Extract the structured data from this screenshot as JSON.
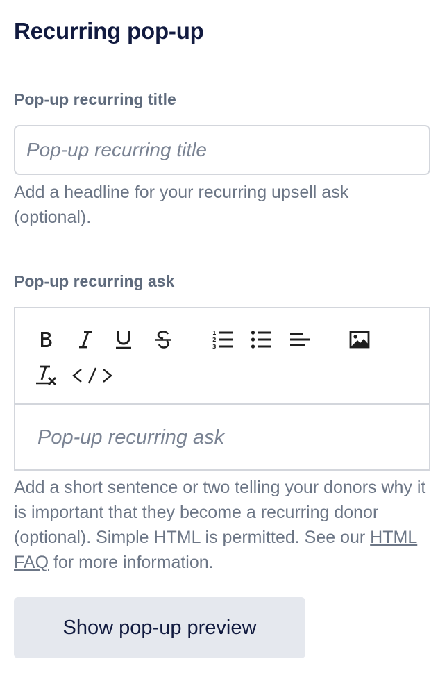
{
  "section": {
    "title": "Recurring pop-up"
  },
  "recurring_title": {
    "label": "Pop-up recurring title",
    "value": "",
    "placeholder": "Pop-up recurring title",
    "help": "Add a headline for your recurring upsell ask (optional)."
  },
  "recurring_ask": {
    "label": "Pop-up recurring ask",
    "placeholder": "Pop-up recurring ask",
    "help_before_link": "Add a short sentence or two telling your donors why it is important that they become a recurring donor (optional). Simple HTML is permitted. See our ",
    "help_link": "HTML FAQ",
    "help_after_link": " for more information.",
    "toolbar": [
      "bold-icon",
      "italic-icon",
      "underline-icon",
      "strikethrough-icon",
      "ordered-list-icon",
      "bullet-list-icon",
      "align-icon",
      "image-icon",
      "clear-format-icon",
      "code-icon"
    ]
  },
  "preview_button": {
    "label": "Show pop-up preview"
  },
  "colors": {
    "heading": "#111a3f",
    "label": "#5f6b7d",
    "help": "#6c7686",
    "border": "#d3d6dc",
    "button_bg": "#e5e8ee"
  }
}
